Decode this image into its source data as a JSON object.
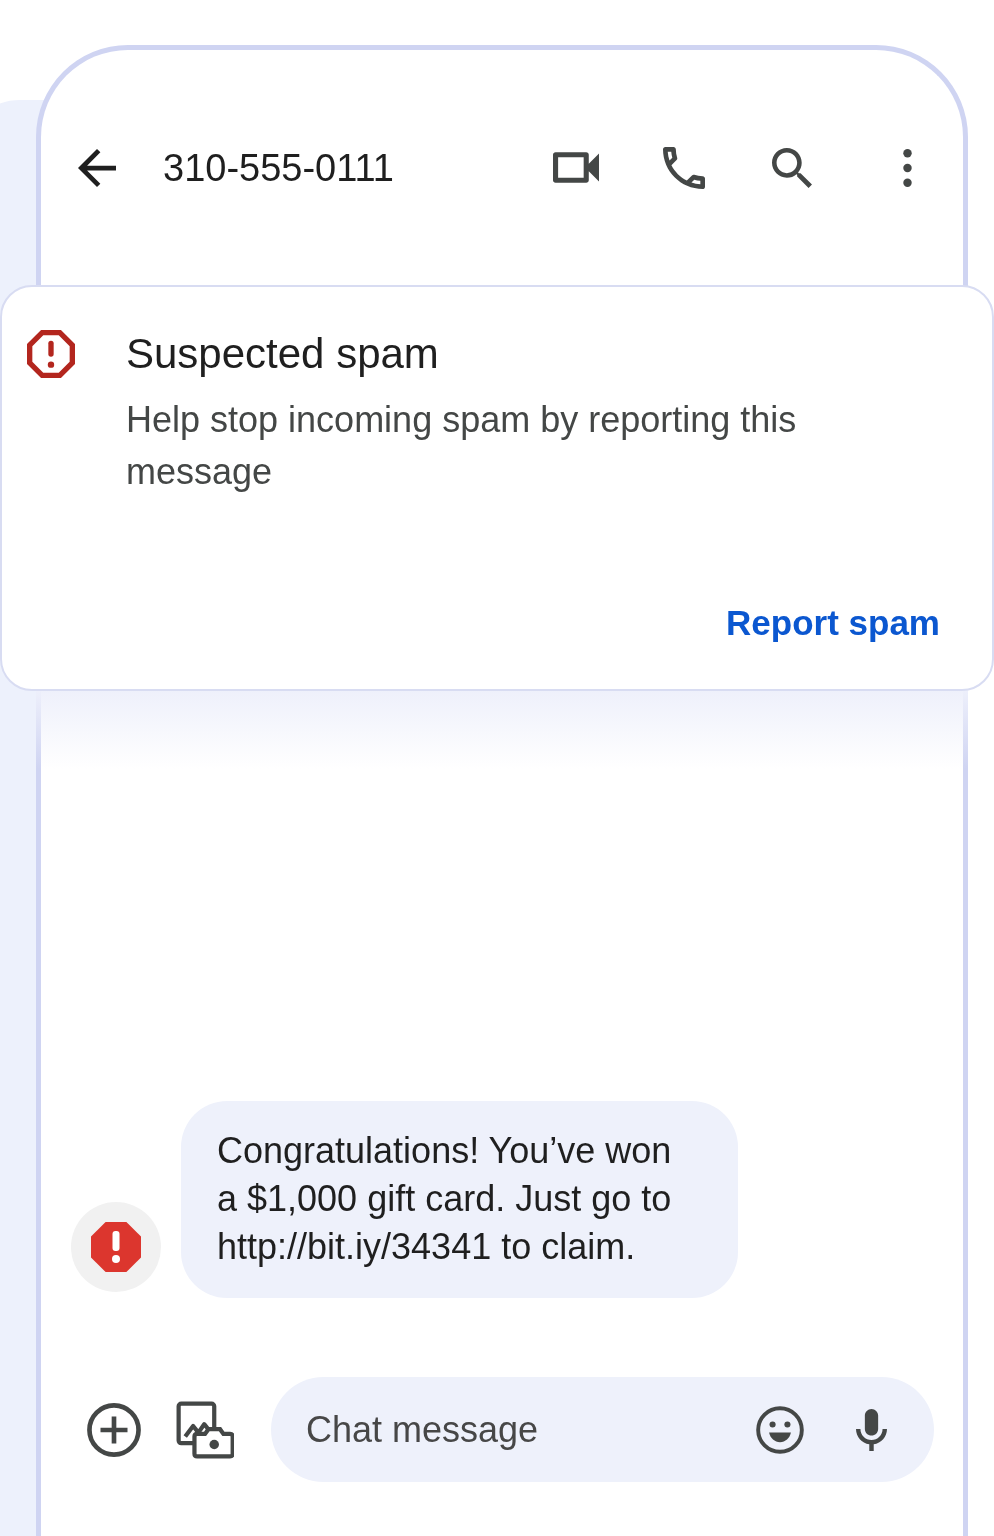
{
  "header": {
    "title": "310-555-0111"
  },
  "spam_banner": {
    "title": "Suspected spam",
    "body": "Help stop incoming spam by reporting this message",
    "action": "Report spam"
  },
  "messages": [
    {
      "text": "Congratulations! You’ve won a $1,000 gift card. Just go to http://bit.iy/34341 to claim.",
      "spam": true
    }
  ],
  "composer": {
    "placeholder": "Chat message"
  }
}
